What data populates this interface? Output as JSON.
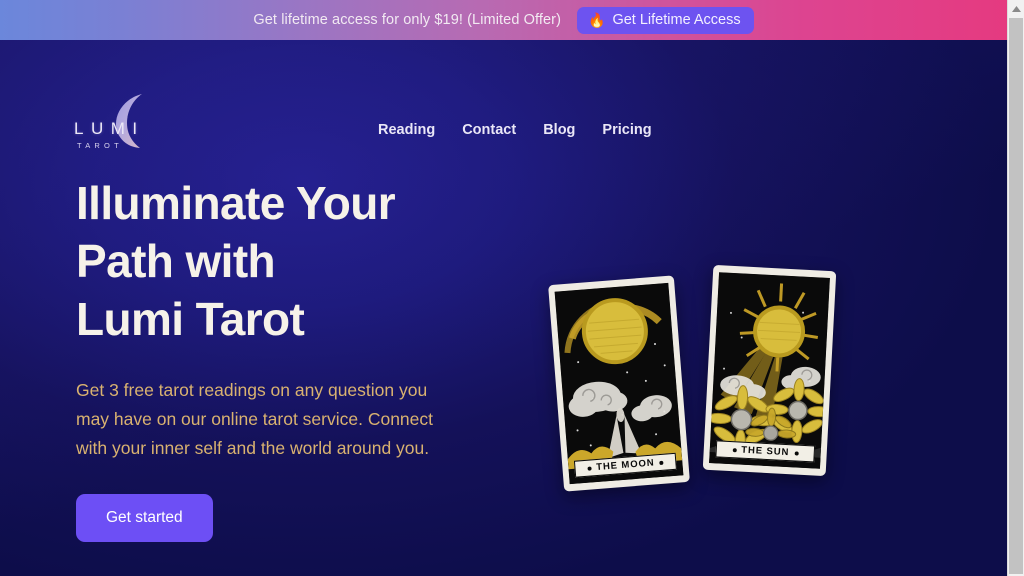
{
  "promo": {
    "text": "Get lifetime access for only $19! (Limited Offer)",
    "cta_label": "Get Lifetime Access",
    "cta_icon": "flame-icon",
    "cta_bg": "#6d53f0",
    "gradient_from": "#6b87db",
    "gradient_to": "#e53a80"
  },
  "header": {
    "logo": {
      "wordmark": "LUMI",
      "sub": "TAROT",
      "icon": "crescent-moon-icon"
    },
    "nav": [
      {
        "label": "Reading"
      },
      {
        "label": "Contact"
      },
      {
        "label": "Blog"
      },
      {
        "label": "Pricing"
      }
    ]
  },
  "hero": {
    "title_line1": "Illuminate Your",
    "title_line2": "Path with",
    "title_line3": "Lumi Tarot",
    "subtitle": "Get 3 free tarot readings on any question you may have on our online tarot service. Connect with your inner self and the world around you.",
    "cta_label": "Get started",
    "cta_bg": "#6d4ff5",
    "title_color": "#f6f2e9",
    "subtitle_color": "#d9b270",
    "background_color": "#0d0d4a"
  },
  "cards": [
    {
      "name": "the-moon-card",
      "title": "THE MOON"
    },
    {
      "name": "the-sun-card",
      "title": "THE SUN"
    }
  ],
  "scrollbar": {
    "arrow_icon": "chevron-up-icon"
  }
}
